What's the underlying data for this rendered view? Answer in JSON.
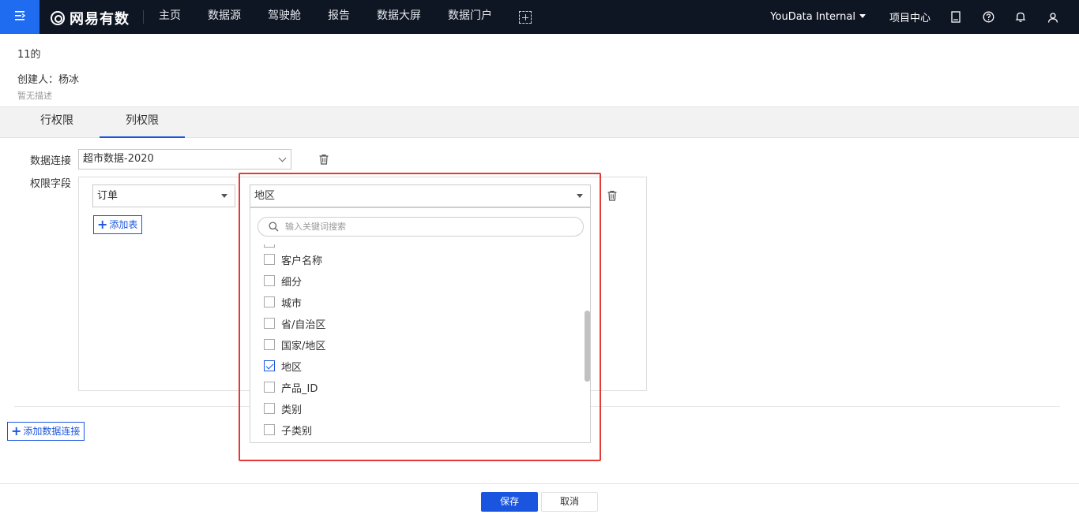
{
  "header": {
    "logo_text": "网易有数",
    "nav": [
      "主页",
      "数据源",
      "驾驶舱",
      "报告",
      "数据大屏",
      "数据门户"
    ],
    "org": "YouData Internal",
    "project_center": "项目中心",
    "icons": [
      "menu-icon",
      "logo-icon",
      "add-icon",
      "book-icon",
      "help-icon",
      "bell-icon",
      "user-icon"
    ]
  },
  "info": {
    "title": "11的",
    "creator": "创建人：杨冰",
    "description": "暂无描述"
  },
  "tabs": [
    {
      "label": "行权限",
      "active": false
    },
    {
      "label": "列权限",
      "active": true
    }
  ],
  "form": {
    "connection_label": "数据连接",
    "connection_value": "超市数据-2020",
    "field_label": "权限字段",
    "table_value": "订单",
    "column_value": "地区",
    "add_table": "添加表",
    "add_connection": "添加数据连接"
  },
  "dropdown": {
    "search_placeholder": "输入关键词搜索",
    "options": [
      {
        "label": "客户名称",
        "checked": false
      },
      {
        "label": "细分",
        "checked": false
      },
      {
        "label": "城市",
        "checked": false
      },
      {
        "label": "省/自治区",
        "checked": false
      },
      {
        "label": "国家/地区",
        "checked": false
      },
      {
        "label": "地区",
        "checked": true
      },
      {
        "label": "产品_ID",
        "checked": false
      },
      {
        "label": "类别",
        "checked": false
      },
      {
        "label": "子类别",
        "checked": false
      }
    ]
  },
  "footer": {
    "save": "保存",
    "cancel": "取消"
  },
  "colors": {
    "topbar": "#0f1623",
    "accent": "#1a55e0",
    "highlight": "#e53935"
  }
}
